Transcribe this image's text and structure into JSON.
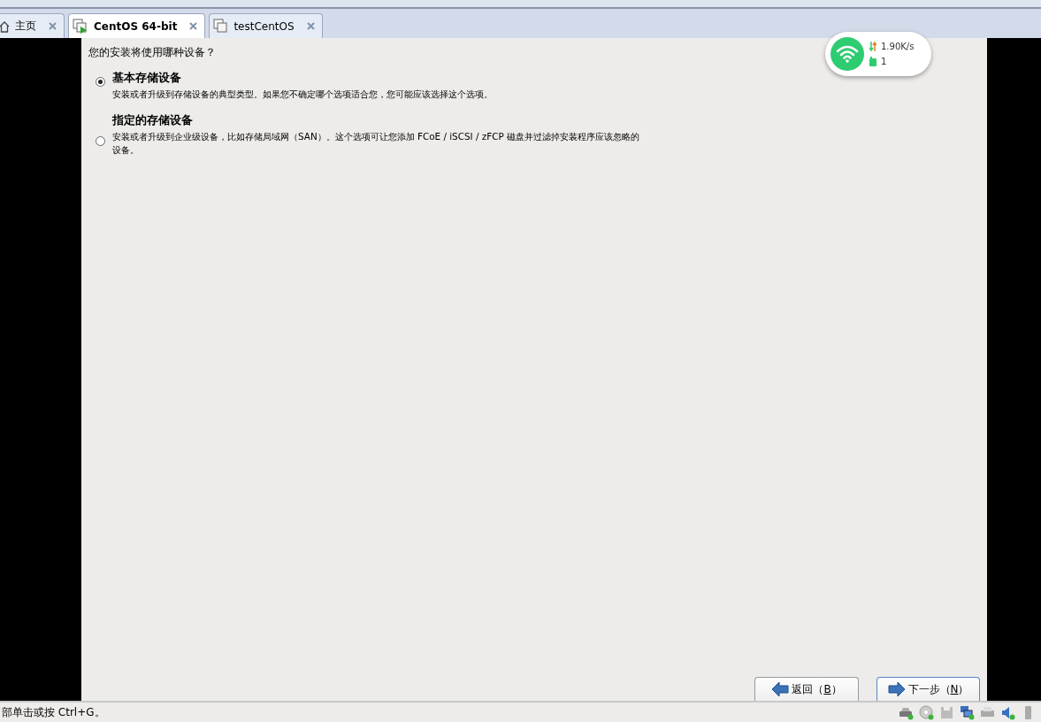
{
  "tabs": [
    {
      "label": "主页",
      "kind": "home",
      "selected": false
    },
    {
      "label": "CentOS 64-bit",
      "kind": "vm-running",
      "selected": true
    },
    {
      "label": "testCentOS",
      "kind": "vm",
      "selected": false
    }
  ],
  "installer": {
    "question": "您的安装将使用哪种设备？",
    "options": [
      {
        "title": "基本存储设备",
        "description": "安装或者升级到存储设备的典型类型。如果您不确定哪个选项适合您，您可能应该选择这个选项。",
        "selected": true
      },
      {
        "title": "指定的存储设备",
        "description": "安装或者升级到企业级设备，比如存储局域网（SAN）。这个选项可让您添加 FCoE / iSCSI / zFCP 磁盘并过滤掉安装程序应该忽略的设备。",
        "selected": false
      }
    ],
    "buttons": [
      {
        "before": "返回（",
        "key": "B",
        "after": "）",
        "kind": "back"
      },
      {
        "before": "下一步（",
        "key": "N",
        "after": "）",
        "kind": "next"
      }
    ]
  },
  "network_widget": {
    "speed": "1.90K/s",
    "devices": "1"
  },
  "status_bar": {
    "text": "部单击或按 Ctrl+G。"
  }
}
